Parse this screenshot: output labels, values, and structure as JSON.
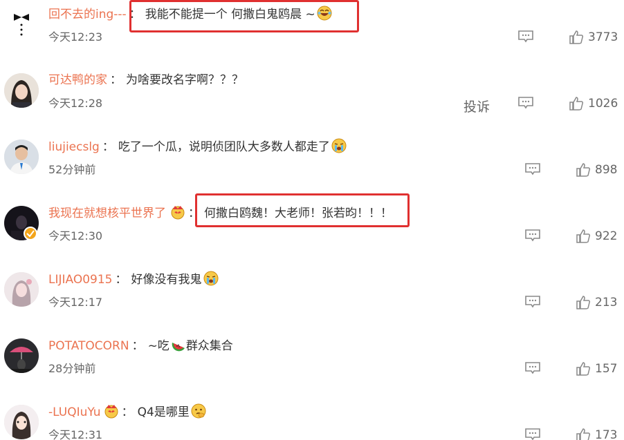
{
  "comments": [
    {
      "user": "回不去的ing---",
      "text": "我能不能提一个 何撒白鬼鸥晨 ~",
      "emoji": "laugh-cry-emoji",
      "time": "今天12:23",
      "likes": "3773"
    },
    {
      "user": "可达鸭的家",
      "text": "为啥要改名字啊？？？",
      "emoji": "",
      "time": "今天12:28",
      "likes": "1026",
      "report": "投诉"
    },
    {
      "user": "liujiecslg",
      "text": "吃了一个瓜，说明侦团队大多数人都走了",
      "emoji": "crying-emoji",
      "time": "52分钟前",
      "likes": "898"
    },
    {
      "user": "我现在就想核平世界了",
      "text": "何撒白鸥魏！大老师！张若昀！！！",
      "emoji": "",
      "time": "今天12:30",
      "likes": "922"
    },
    {
      "user": "LIJIAO0915",
      "text": "好像没有我鬼",
      "emoji": "crying-emoji",
      "time": "今天12:17",
      "likes": "213"
    },
    {
      "user": "POTATOCORN",
      "text": "~吃",
      "text2": "群众集合",
      "emoji": "watermelon-emoji",
      "time": "28分钟前",
      "likes": "157"
    },
    {
      "user": "-LUQIuYu",
      "text": "Q4是哪里",
      "emoji": "hmm-emoji",
      "time": "今天12:31",
      "likes": "173"
    }
  ],
  "separator": "：",
  "colors": {
    "username": "#eb7350",
    "highlight": "#e03030",
    "verified": "#f3a51b"
  }
}
